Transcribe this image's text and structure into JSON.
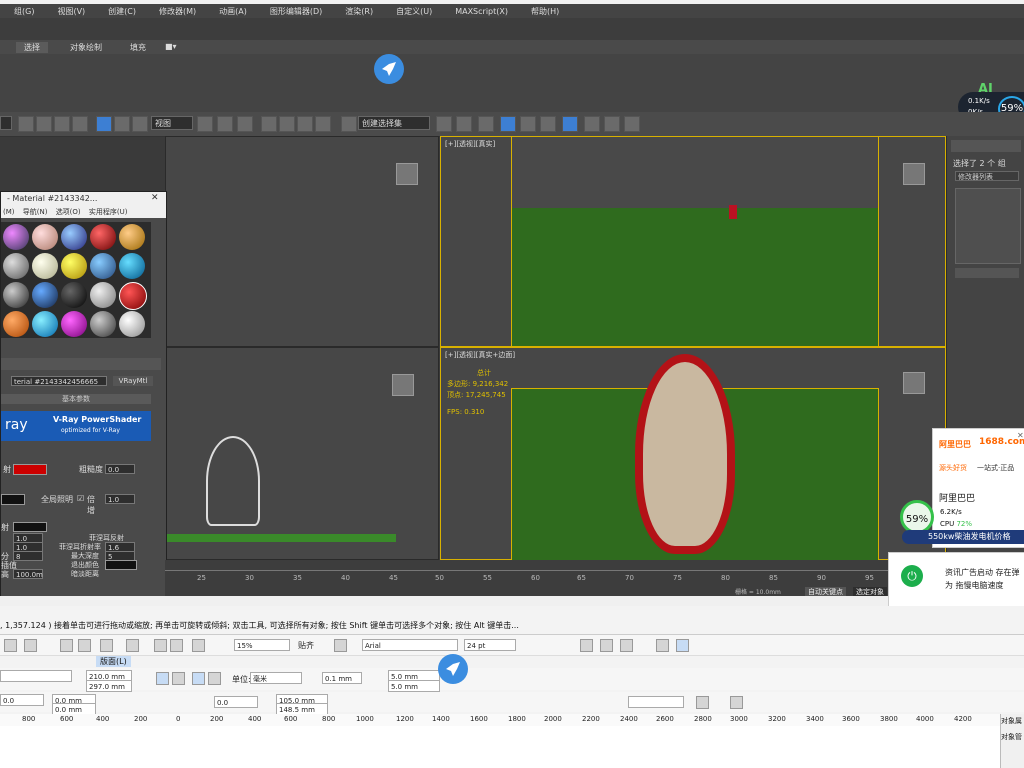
{
  "menubar": {
    "items": [
      "组(G)",
      "视图(V)",
      "创建(C)",
      "修改器(M)",
      "动画(A)",
      "图形编辑器(D)",
      "渲染(R)",
      "自定义(U)",
      "MAXScript(X)",
      "帮助(H)"
    ]
  },
  "ribbon": {
    "tabs": [
      "选择",
      "对象绘制",
      "填充"
    ],
    "active_tab": "选择"
  },
  "toolbar": {
    "view_dropdown": "视图",
    "selection_set": "创建选择集"
  },
  "ai_badge": "AI",
  "perf": {
    "up": "0.1K/s",
    "down": "0K/s",
    "cpu_percent": "59%"
  },
  "viewports": {
    "top_right_label": "[+][透视][真实]",
    "bottom_right_label": "[+][透视][真实+边面]",
    "stats": {
      "total_label": "总计",
      "polys_label": "多边形:",
      "polys_value": "9,216,342",
      "verts_label": "顶点:",
      "verts_value": "17,245,745",
      "fps_label": "FPS:",
      "fps_value": "0.310"
    }
  },
  "command_panel": {
    "selection_info": "选择了 2 个 组",
    "modifier_list": "修改器列表"
  },
  "material_editor": {
    "title": "- Material #2143342...",
    "menus": [
      "(M)",
      "导航(N)",
      "选项(O)",
      "实用程序(U)"
    ],
    "material_name": "terial #2143342456665",
    "material_type": "VRayMtl",
    "rollout_title": "基本参数",
    "vray_title": "V-Ray PowerShader",
    "vray_subtitle": "optimized for V-Ray",
    "vray_logo": "ray",
    "rows": {
      "diffuse": "射",
      "roughness": "粗糙度",
      "roughness_value": "0.0",
      "fresnel_label": "全局照明",
      "multiplier_label": "倍增",
      "multiplier_value": "1.0",
      "reflect": "射",
      "fresnel_reflect": "菲涅耳反射",
      "fresnel_ior": "菲涅耳折射率",
      "max_depth": "最大深度",
      "exit_color": "退出颜色",
      "dim_distance": "暗淡距离",
      "val_1": "1.0",
      "val_2": "1.0",
      "val_3": "8",
      "val_4": "1.6",
      "val_5": "5",
      "val_6": "100.0m",
      "side_1": "分",
      "side_2": "插值",
      "side_3": "高"
    }
  },
  "timeline": {
    "ticks": [
      "25",
      "30",
      "35",
      "40",
      "45",
      "50",
      "55",
      "60",
      "65",
      "70",
      "75",
      "80",
      "85",
      "90",
      "95"
    ],
    "grid_label": "栅格 = 10.0mm",
    "auto_key": "自动关键点",
    "selected": "选定对象"
  },
  "corel": {
    "status": ", 1,357.124 ) 接着单击可进行拖动或缩放; 再单击可旋转或倾斜; 双击工具, 可选择所有对象; 按住 Shift 键单击可选择多个对象; 按住 Alt 键单击...",
    "zoom": "15%",
    "snap": "贴齐",
    "font": "Arial",
    "font_size": "24 pt",
    "page_tab": "版面(L)",
    "width": "210.0 mm",
    "height": "297.0 mm",
    "units_label": "单位:",
    "units": "毫米",
    "nudge": "0.1 mm",
    "dup_x": "5.0 mm",
    "dup_y": "5.0 mm",
    "pos_1": "0.0",
    "pos_2": "0.0 mm",
    "pos_3": "0.0 mm",
    "pos_4": "0.0",
    "val_105": "105.0 mm",
    "val_148": "148.5 mm",
    "ruler": [
      "800",
      "600",
      "400",
      "200",
      "0",
      "200",
      "400",
      "600",
      "800",
      "1000",
      "1200",
      "1400",
      "1600",
      "1800",
      "2000",
      "2200",
      "2400",
      "2600",
      "2800",
      "3000",
      "3200",
      "3400",
      "3600",
      "3800",
      "4000",
      "4200"
    ],
    "docker_1": "对象属",
    "docker_2": "对象管"
  },
  "ads": {
    "ali_brand": "阿里巴巴",
    "ali_site": "1688.com",
    "ali_tagline": "源头好货",
    "ali_tagline2": "一站式·正品",
    "ali_title": "阿里巴巴",
    "net_speed": "6.2K/s",
    "cpu_label": "CPU",
    "cpu_value": "72%",
    "ball_percent": "59%",
    "headline": "550kw柴油发电机价格",
    "pop_line1": "资讯广告启动 存在弹",
    "pop_line2": "为 拖慢电脑速度"
  },
  "colors": {
    "max_bg": "#474747",
    "selection_yellow": "#d8b100",
    "grass": "#2f6b1e",
    "vray_blue": "#1a5bb5",
    "accent_blue": "#3d7fd3"
  }
}
